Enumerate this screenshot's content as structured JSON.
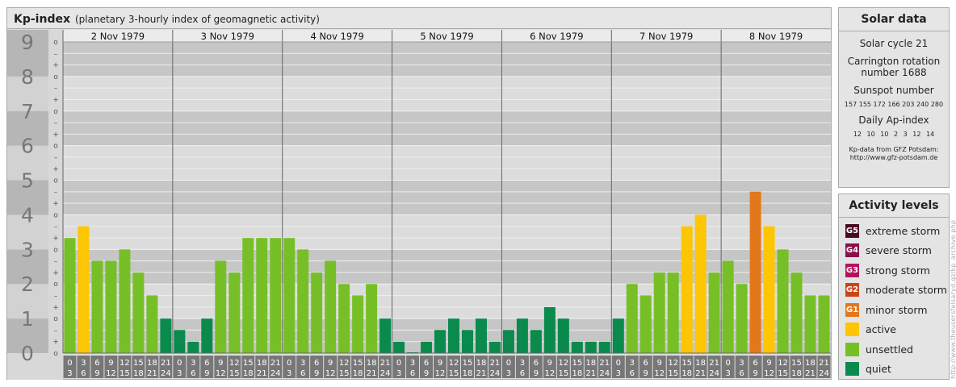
{
  "header": {
    "title": "Kp-index",
    "subtitle": "(planetary 3-hourly index of geomagnetic activity)"
  },
  "chart_data": {
    "type": "bar",
    "ylim": [
      0,
      9
    ],
    "y_ticks": [
      "0",
      "1",
      "2",
      "3",
      "4",
      "5",
      "6",
      "7",
      "8",
      "9"
    ],
    "y_minor_labels": [
      "o",
      "+",
      "–"
    ],
    "days": [
      "2 Nov 1979",
      "3 Nov 1979",
      "4 Nov 1979",
      "5 Nov 1979",
      "6 Nov 1979",
      "7 Nov 1979",
      "8 Nov 1979"
    ],
    "interval_start_hours": [
      "0",
      "3",
      "6",
      "9",
      "12",
      "15",
      "18",
      "21"
    ],
    "interval_end_hours": [
      "3",
      "6",
      "9",
      "12",
      "15",
      "18",
      "21",
      "24"
    ],
    "values": [
      3.33,
      3.67,
      2.67,
      2.67,
      3.0,
      2.33,
      1.67,
      1.0,
      0.67,
      0.33,
      1.0,
      2.67,
      2.33,
      3.33,
      3.33,
      3.33,
      3.33,
      3.0,
      2.33,
      2.67,
      2.0,
      1.67,
      2.0,
      1.0,
      0.33,
      0.0,
      0.33,
      0.67,
      1.0,
      0.67,
      1.0,
      0.33,
      0.67,
      1.0,
      0.67,
      1.33,
      1.0,
      0.33,
      0.33,
      0.33,
      1.0,
      2.0,
      1.67,
      2.33,
      2.33,
      3.67,
      4.0,
      2.33,
      2.67,
      2.0,
      4.67,
      3.67,
      3.0,
      2.33,
      1.67,
      1.67
    ],
    "colors": {
      "quiet": "#0a8a4c",
      "unsettled": "#77bf26",
      "active": "#fdc503",
      "minor_storm": "#e3781b",
      "moderate_storm": "#cc4317",
      "strong_storm": "#b3135e",
      "severe_storm": "#8a0f4b",
      "extreme_storm": "#4a0a25"
    },
    "thresholds": {
      "unsettled": 1.67,
      "active": 3.67,
      "minor_storm": 4.67,
      "moderate_storm": 5.67,
      "strong_storm": 6.67,
      "severe_storm": 7.67,
      "extreme_storm": 8.67
    }
  },
  "solar": {
    "title": "Solar data",
    "cycle": "Solar cycle 21",
    "carrington": "Carrington rotation number 1688",
    "sunspot_label": "Sunspot number",
    "sunspot_values": "157 155 172 166 203 240 280",
    "ap_label": "Daily Ap-index",
    "ap_values": "12 10 10 2 3 12 14",
    "source_line1": "Kp-data from GFZ Potsdam:",
    "source_line2": "http://www.gfz-potsdam.de"
  },
  "levels": {
    "title": "Activity levels",
    "items": [
      {
        "code": "G5",
        "label": "extreme storm",
        "color": "#4a0a25"
      },
      {
        "code": "G4",
        "label": "severe storm",
        "color": "#8a0f4b"
      },
      {
        "code": "G3",
        "label": "strong storm",
        "color": "#b3135e"
      },
      {
        "code": "G2",
        "label": "moderate storm",
        "color": "#cc4317"
      },
      {
        "code": "G1",
        "label": "minor storm",
        "color": "#e3781b"
      },
      {
        "code": "",
        "label": "active",
        "color": "#fdc503"
      },
      {
        "code": "",
        "label": "unsettled",
        "color": "#77bf26"
      },
      {
        "code": "",
        "label": "quiet",
        "color": "#0a8a4c"
      }
    ]
  },
  "credit": "http://www.theusersfelsaryd.gz/kp_archive.php"
}
